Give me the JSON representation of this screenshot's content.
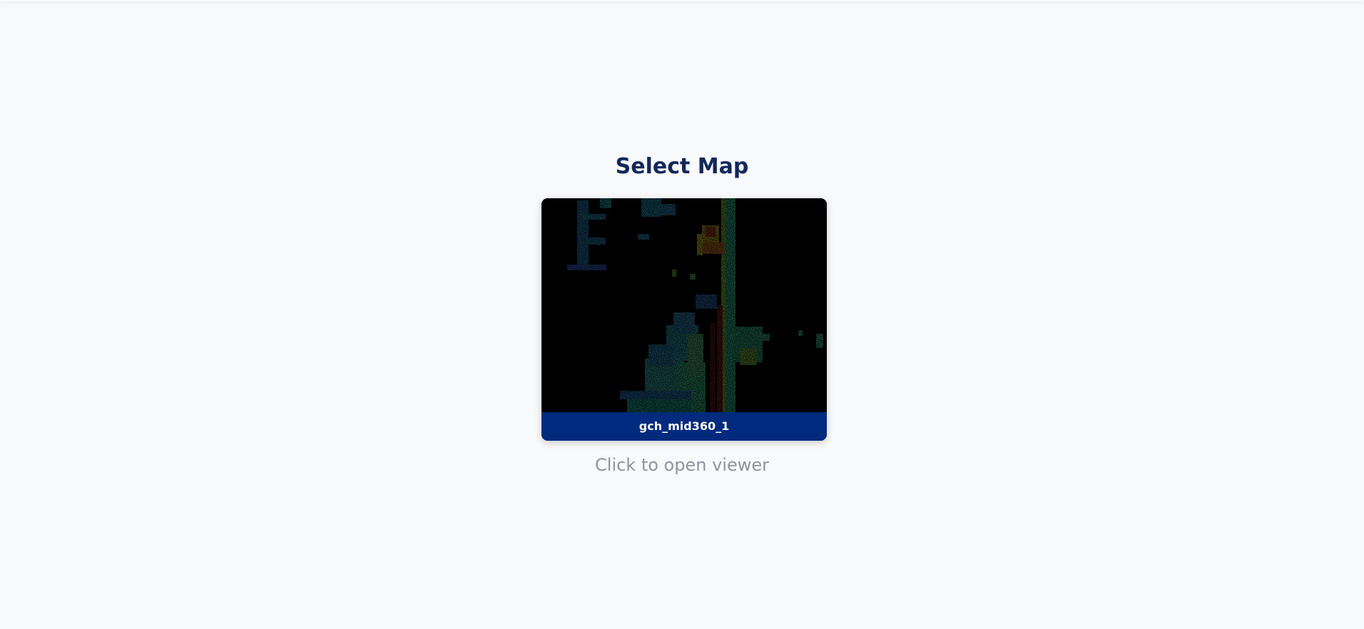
{
  "page": {
    "title": "Select Map",
    "hint": "Click to open viewer"
  },
  "maps": [
    {
      "name": "gch_mid360_1",
      "thumbnail_icon": "point-cloud-preview"
    }
  ],
  "colors": {
    "background": "#f8f9fb",
    "title": "#14275a",
    "card_label_bg": "#002a7d",
    "card_label_text": "#ffffff",
    "hint": "#8f949c",
    "thumbnail_bg": "#000000"
  }
}
